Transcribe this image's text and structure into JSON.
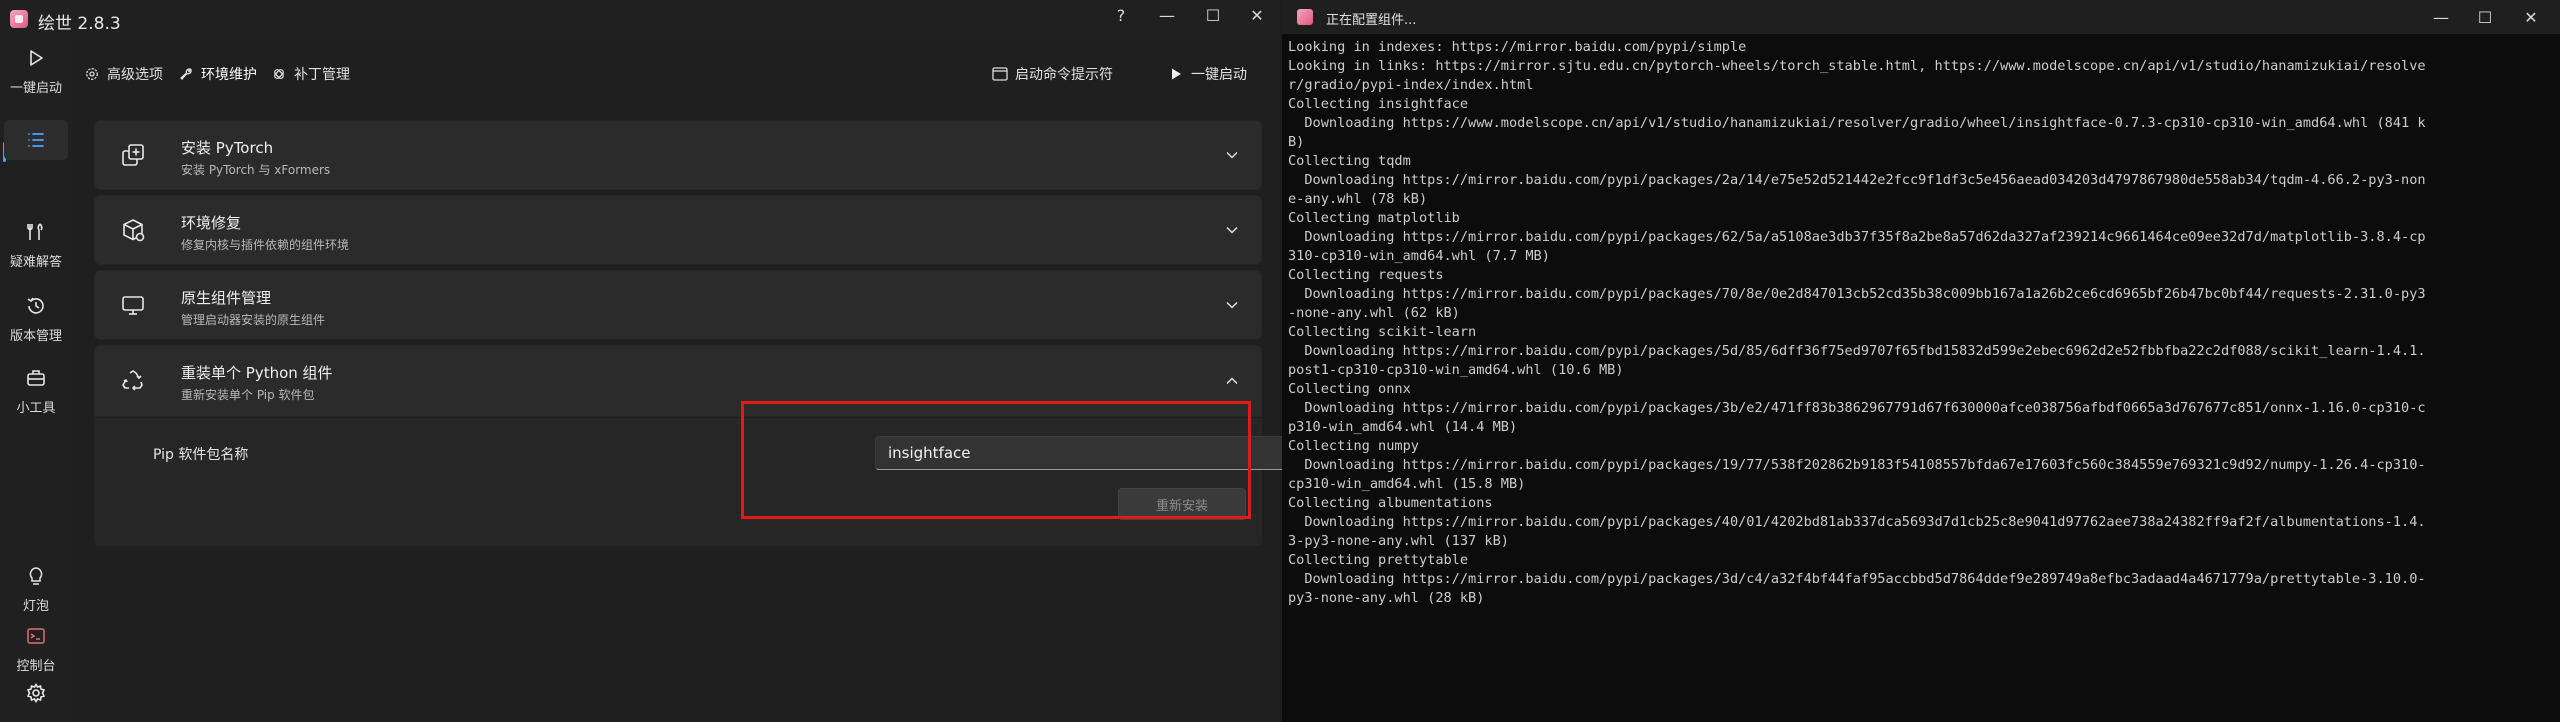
{
  "app": {
    "title": "绘世 2.8.3",
    "window_controls": [
      "?",
      "—",
      "☐",
      "✕"
    ]
  },
  "sidebar": {
    "items": [
      {
        "label": "一键启动",
        "icon": "play-icon"
      },
      {
        "label": "",
        "icon": "list-icon",
        "active": true
      },
      {
        "label": "疑难解答",
        "icon": "tools-icon"
      },
      {
        "label": "版本管理",
        "icon": "history-icon"
      },
      {
        "label": "小工具",
        "icon": "toolbox-icon"
      },
      {
        "label": "灯泡",
        "icon": "lightbulb-icon"
      },
      {
        "label": "控制台",
        "icon": "console-icon"
      },
      {
        "label": "",
        "icon": "gear-icon"
      }
    ]
  },
  "tabs": [
    {
      "label": "高级选项",
      "icon": "gear-small-icon"
    },
    {
      "label": "环境维护",
      "icon": "wrench-icon",
      "active": true
    },
    {
      "label": "补丁管理",
      "icon": "patch-icon"
    }
  ],
  "actions": {
    "terminal": "启动命令提示符",
    "launch": "一键启动"
  },
  "cards": [
    {
      "title": "安装 PyTorch",
      "subtitle": "安装 PyTorch 与 xFormers",
      "icon": "package-add-icon"
    },
    {
      "title": "环境修复",
      "subtitle": "修复内核与插件依赖的组件环境",
      "icon": "box-repair-icon"
    },
    {
      "title": "原生组件管理",
      "subtitle": "管理启动器安装的原生组件",
      "icon": "monitor-icon"
    },
    {
      "title": "重装单个 Python 组件",
      "subtitle": "重新安装单个 Pip 软件包",
      "icon": "recycle-icon"
    }
  ],
  "reinstall": {
    "label": "Pip 软件包名称",
    "value": "insightface",
    "button": "重新安装"
  },
  "console": {
    "title": "正在配置组件...",
    "window_controls": [
      "—",
      "☐",
      "✕"
    ],
    "lines": [
      "Looking in indexes: https://mirror.baidu.com/pypi/simple",
      "Looking in links: https://mirror.sjtu.edu.cn/pytorch-wheels/torch_stable.html, https://www.modelscope.cn/api/v1/studio/hanamizukiai/resolve",
      "r/gradio/pypi-index/index.html",
      "Collecting insightface",
      "  Downloading https://www.modelscope.cn/api/v1/studio/hanamizukiai/resolver/gradio/wheel/insightface-0.7.3-cp310-cp310-win_amd64.whl (841 k",
      "B)",
      "Collecting tqdm",
      "  Downloading https://mirror.baidu.com/pypi/packages/2a/14/e75e52d521442e2fcc9f1df3c5e456aead034203d4797867980de558ab34/tqdm-4.66.2-py3-non",
      "e-any.whl (78 kB)",
      "Collecting matplotlib",
      "  Downloading https://mirror.baidu.com/pypi/packages/62/5a/a5108ae3db37f35f8a2be8a57d62da327af239214c9661464ce09ee32d7d/matplotlib-3.8.4-cp",
      "310-cp310-win_amd64.whl (7.7 MB)",
      "Collecting requests",
      "  Downloading https://mirror.baidu.com/pypi/packages/70/8e/0e2d847013cb52cd35b38c009bb167a1a26b2ce6cd6965bf26b47bc0bf44/requests-2.31.0-py3",
      "-none-any.whl (62 kB)",
      "Collecting scikit-learn",
      "  Downloading https://mirror.baidu.com/pypi/packages/5d/85/6dff36f75ed9707f65fbd15832d599e2ebec6962d2e52fbbfba22c2df088/scikit_learn-1.4.1.",
      "post1-cp310-cp310-win_amd64.whl (10.6 MB)",
      "Collecting onnx",
      "  Downloading https://mirror.baidu.com/pypi/packages/3b/e2/471ff83b3862967791d67f630000afce038756afbdf0665a3d767677c851/onnx-1.16.0-cp310-c",
      "p310-win_amd64.whl (14.4 MB)",
      "Collecting numpy",
      "  Downloading https://mirror.baidu.com/pypi/packages/19/77/538f202862b9183f54108557bfda67e17603fc560c384559e769321c9d92/numpy-1.26.4-cp310-",
      "cp310-win_amd64.whl (15.8 MB)",
      "Collecting albumentations",
      "  Downloading https://mirror.baidu.com/pypi/packages/40/01/4202bd81ab337dca5693d7d1cb25c8e9041d97762aee738a24382ff9af2f/albumentations-1.4.",
      "3-py3-none-any.whl (137 kB)",
      "Collecting prettytable",
      "  Downloading https://mirror.baidu.com/pypi/packages/3d/c4/a32f4bf44faf95accbbd5d7864ddef9e289749a8efbc3adaad4a4671779a/prettytable-3.10.0-",
      "py3-none-any.whl (28 kB)"
    ]
  },
  "colors": {
    "accent": "#4aa3ff",
    "highlight": "#e01919",
    "console_bg": "#0c0c0c"
  }
}
